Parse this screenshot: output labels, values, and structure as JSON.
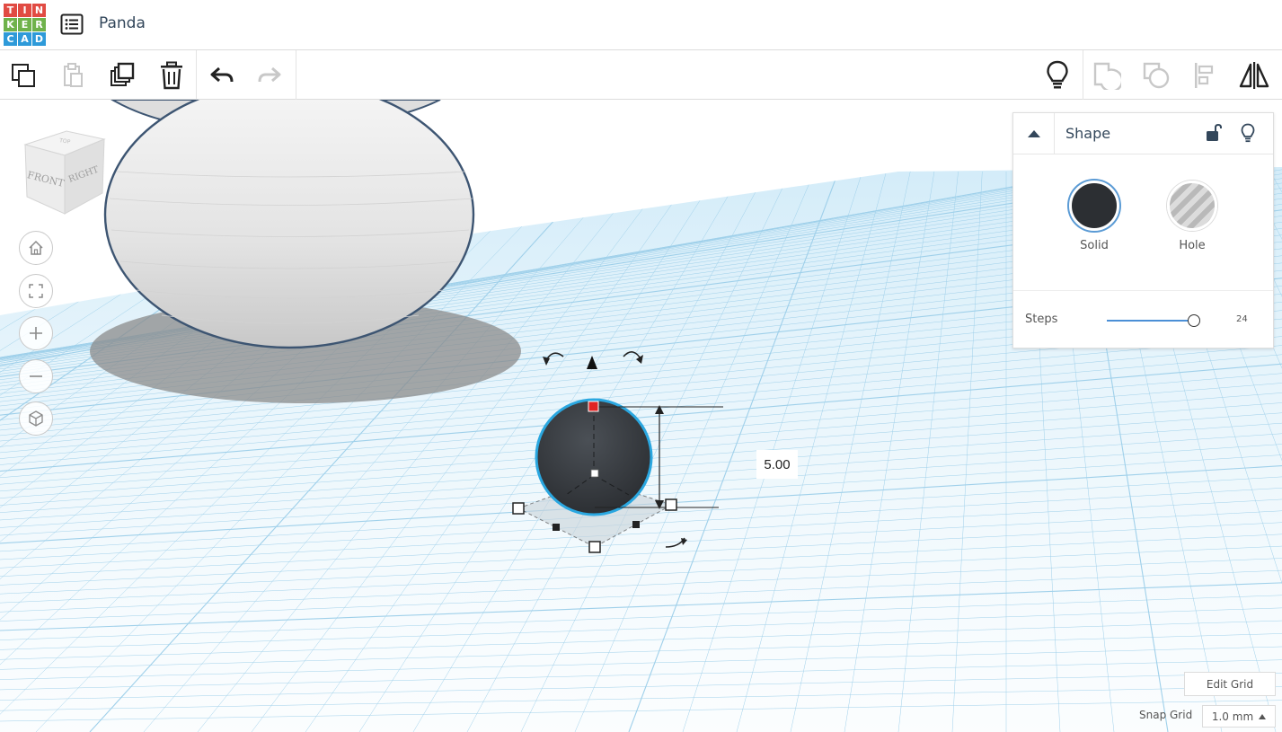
{
  "app": {
    "logo_letters": [
      "T",
      "I",
      "N",
      "K",
      "E",
      "R",
      "C",
      "A",
      "D"
    ],
    "logo_colors": [
      "#e14b43",
      "#e14b43",
      "#e14b43",
      "#6fb24b",
      "#6fb24b",
      "#6fb24b",
      "#2e9ad9",
      "#2e9ad9",
      "#2e9ad9"
    ],
    "design_title": "Panda"
  },
  "toolbar": {
    "left": [
      {
        "name": "copy-button",
        "icon": "copy-icon",
        "enabled": true
      },
      {
        "name": "paste-button",
        "icon": "paste-icon",
        "enabled": false
      },
      {
        "name": "duplicate-button",
        "icon": "duplicate-icon",
        "enabled": true
      },
      {
        "name": "delete-button",
        "icon": "trash-icon",
        "enabled": true
      },
      {
        "name": "undo-button",
        "icon": "undo-icon",
        "enabled": true
      },
      {
        "name": "redo-button",
        "icon": "redo-icon",
        "enabled": false
      }
    ],
    "right": [
      {
        "name": "show-all-button",
        "icon": "lightbulb-icon",
        "enabled": true
      },
      {
        "name": "group-button",
        "icon": "group-icon",
        "enabled": false
      },
      {
        "name": "ungroup-button",
        "icon": "ungroup-icon",
        "enabled": false
      },
      {
        "name": "align-button",
        "icon": "align-icon",
        "enabled": false
      },
      {
        "name": "mirror-button",
        "icon": "mirror-icon",
        "enabled": true
      }
    ]
  },
  "view_cube": {
    "front_label": "FRONT",
    "right_label": "RIGHT",
    "top_label": "TOP"
  },
  "nav_controls": [
    {
      "name": "home-view-button",
      "icon": "home-icon"
    },
    {
      "name": "fit-view-button",
      "icon": "fit-icon"
    },
    {
      "name": "zoom-in-button",
      "icon": "plus-icon"
    },
    {
      "name": "zoom-out-button",
      "icon": "minus-icon"
    },
    {
      "name": "ortho-view-button",
      "icon": "perspective-cube-icon"
    }
  ],
  "inspector": {
    "title": "Shape",
    "solid_label": "Solid",
    "hole_label": "Hole",
    "solid_color": "#2c2f33",
    "steps_label": "Steps",
    "steps_value": "24",
    "steps_fraction": 1.0
  },
  "selection": {
    "dimension_value": "5.00",
    "outline_color": "#2aa7e0",
    "handle_color": "#e02424"
  },
  "grid": {
    "edit_grid_label": "Edit Grid",
    "snap_grid_label": "Snap Grid",
    "snap_value": "1.0 mm",
    "line_color": "#9fd0ea"
  }
}
